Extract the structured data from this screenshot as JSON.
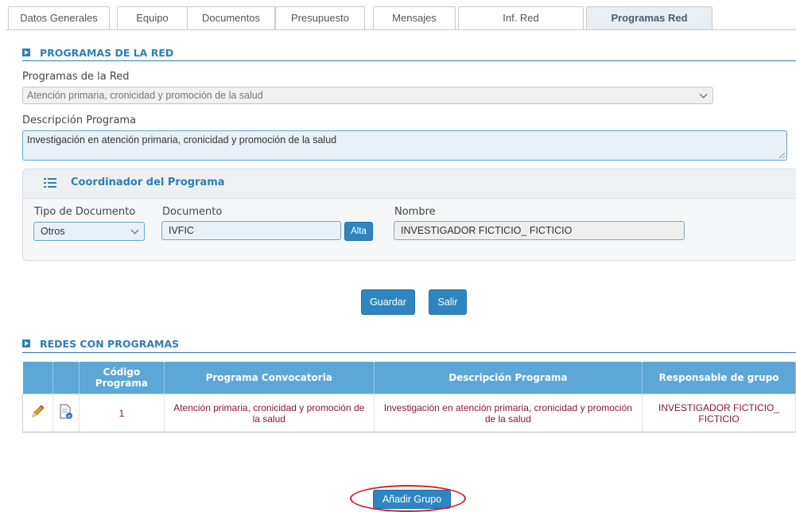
{
  "tabs": [
    {
      "label": "Datos Generales",
      "active": false
    },
    {
      "label": "Equipo",
      "active": false
    },
    {
      "label": "Documentos",
      "active": false
    },
    {
      "label": "Presupuesto",
      "active": false
    },
    {
      "label": "Mensajes",
      "active": false
    },
    {
      "label": "Inf. Red",
      "active": false
    },
    {
      "label": "Programas Red",
      "active": true
    }
  ],
  "section_programas": {
    "title": "PROGRAMAS DE LA RED"
  },
  "programa_field": {
    "label": "Programas de la Red",
    "value": "Atención primaria, cronicidad y promoción de la salud"
  },
  "descripcion_field": {
    "label": "Descripción Programa",
    "value": "Investigación en atención primaria, cronicidad y promoción de la salud"
  },
  "coordinador": {
    "title": "Coordinador del Programa",
    "tipo_documento": {
      "label": "Tipo de Documento",
      "value": "Otros"
    },
    "documento": {
      "label": "Documento",
      "value": "IVFIC"
    },
    "alta_button": "Alta",
    "nombre": {
      "label": "Nombre",
      "value": "INVESTIGADOR FICTICIO_ FICTICIO"
    }
  },
  "actions": {
    "guardar": "Guardar",
    "salir": "Salir"
  },
  "section_redes": {
    "title": "REDES CON PROGRAMAS"
  },
  "table": {
    "headers": {
      "codigo": "Código Programa",
      "programa": "Programa Convocatoria",
      "descripcion": "Descripción Programa",
      "responsable": "Responsable de grupo"
    },
    "rows": [
      {
        "codigo": "1",
        "programa": "Atención primaria, cronicidad y promoción de la salud",
        "descripcion": "Investigación en atención primaria, cronicidad y promoción de la salud",
        "responsable": "INVESTIGADOR FICTICIO_ FICTICIO",
        "icons": [
          "pencil-icon",
          "document-icon"
        ]
      }
    ]
  },
  "add_group_button": "Añadir Grupo",
  "colors": {
    "accent": "#2c7fb5",
    "button": "#2e86c1",
    "table_header": "#5da7d6",
    "cell_text": "#8a1538",
    "highlight": "#d62027"
  }
}
